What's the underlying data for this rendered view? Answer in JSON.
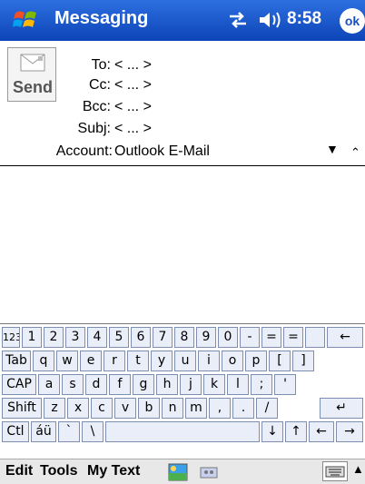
{
  "titlebar": {
    "title": "Messaging",
    "time": "8:58",
    "ok": "ok"
  },
  "send": {
    "label": "Send"
  },
  "fields": {
    "to": {
      "label": "To:",
      "value": "< ... >"
    },
    "cc": {
      "label": "Cc:",
      "value": "< ... >"
    },
    "bcc": {
      "label": "Bcc:",
      "value": "< ... >"
    },
    "subj": {
      "label": "Subj:",
      "value": "< ... >"
    },
    "account": {
      "label": "Account:",
      "value": "Outlook E-Mail"
    }
  },
  "keyboard": {
    "row1": [
      "123",
      "1",
      "2",
      "3",
      "4",
      "5",
      "6",
      "7",
      "8",
      "9",
      "0",
      "-",
      "=",
      "←"
    ],
    "row2": [
      "Tab",
      "q",
      "w",
      "e",
      "r",
      "t",
      "y",
      "u",
      "i",
      "o",
      "p",
      "[",
      "]"
    ],
    "row3": [
      "CAP",
      "a",
      "s",
      "d",
      "f",
      "g",
      "h",
      "j",
      "k",
      "l",
      ";",
      "'"
    ],
    "row4": [
      "Shift",
      "z",
      "x",
      "c",
      "v",
      "b",
      "n",
      "m",
      ",",
      ".",
      "/",
      "↵"
    ],
    "row5": [
      "Ctl",
      "áü",
      "`",
      "\\",
      "",
      "↓",
      "↑",
      "←",
      "→"
    ]
  },
  "menubar": {
    "edit": "Edit",
    "tools": "Tools",
    "mytext": "My Text"
  },
  "icons": {
    "start": "windows-flag-icon",
    "connectivity": "connectivity-icon",
    "volume": "volume-icon",
    "send_envelope": "envelope-icon",
    "dropdown": "dropdown-arrow-icon",
    "collapse": "collapse-header-icon",
    "insert_picture": "picture-icon",
    "insert_recording": "recording-icon",
    "keyboard": "keyboard-icon"
  },
  "colors": {
    "titlebar": "#1a55cc",
    "key_bg": "#e9eef8",
    "key_border": "#7d8fb0"
  }
}
